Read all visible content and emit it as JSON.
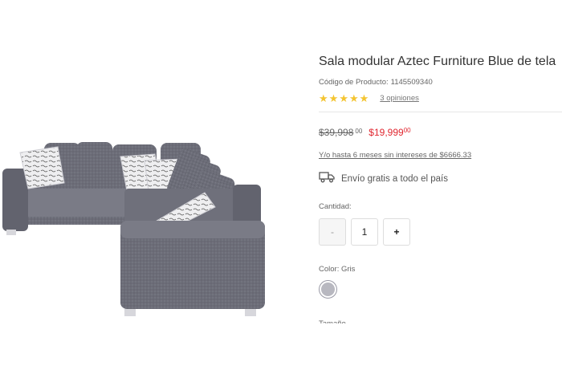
{
  "product": {
    "title": "Sala modular Aztec Furniture Blue de tela",
    "code_label": "Código de Producto:",
    "code_value": "1145509340",
    "rating_stars": 5,
    "reviews_label": "3 opiniones",
    "price_old": "$39,998",
    "price_old_cents": "00",
    "price_new": "$19,999",
    "price_new_cents": "00",
    "installments": "Y/o hasta 6 meses sin intereses de $6666.33",
    "shipping_icon": "truck-icon",
    "shipping_label": "Envío gratis a todo el país",
    "quantity_label": "Cantidad:",
    "quantity_minus": "-",
    "quantity_value": "1",
    "quantity_plus": "+",
    "color_label": "Color: Gris",
    "color_swatch": "#b8b8c0",
    "cut_text": "Tamaño"
  },
  "colors": {
    "accent_red": "#e0262f",
    "star": "#f4c430"
  }
}
